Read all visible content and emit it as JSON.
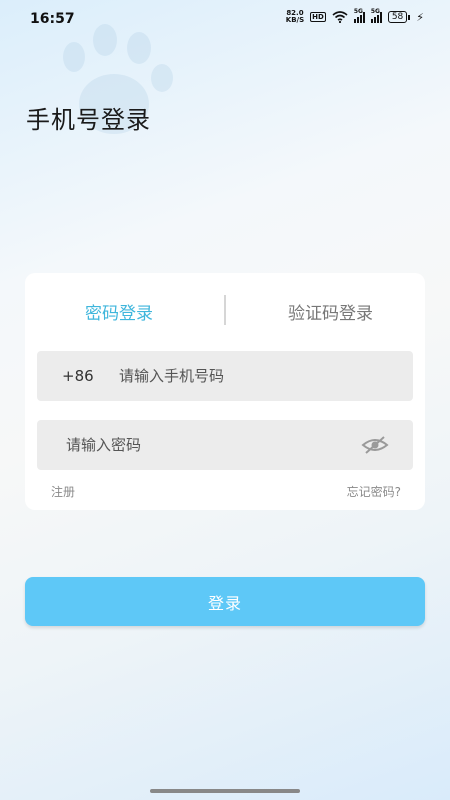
{
  "status_bar": {
    "time": "16:57",
    "net_speed_value": "82.0",
    "net_speed_unit": "KB/S",
    "hd_label": "HD",
    "signal1_label": "5G",
    "signal2_label": "5G",
    "battery": "58",
    "icons": [
      "wifi-icon",
      "signal-icon",
      "signal-icon",
      "battery-icon",
      "charging-icon"
    ]
  },
  "header": {
    "title": "手机号登录"
  },
  "tabs": {
    "password_login": "密码登录",
    "code_login": "验证码登录",
    "active": "password_login",
    "active_color": "#3fb6dc"
  },
  "form": {
    "country_code": "+86",
    "phone_placeholder": "请输入手机号码",
    "password_placeholder": "请输入密码",
    "password_toggle_icon": "eye-off-icon"
  },
  "links": {
    "register": "注册",
    "forgot_password": "忘记密码?"
  },
  "login_button": {
    "label": "登录",
    "color": "#5ec8f7"
  }
}
